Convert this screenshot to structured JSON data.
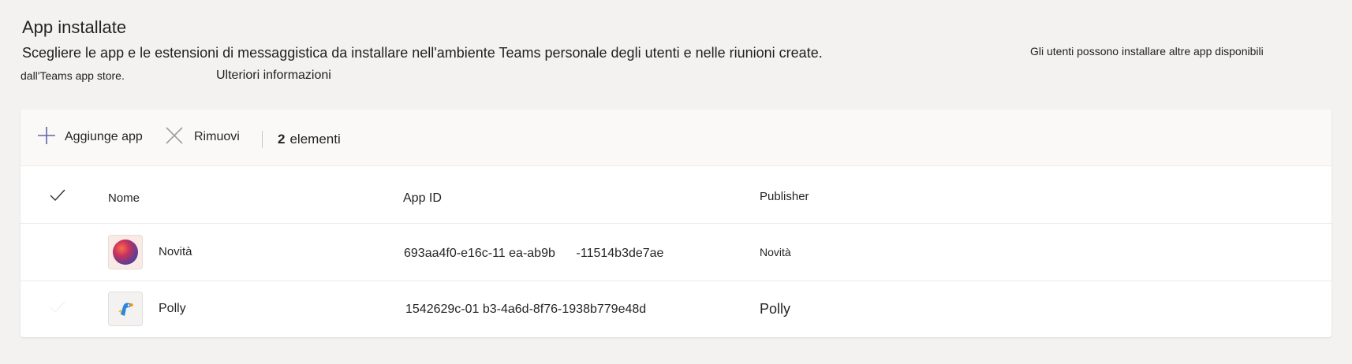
{
  "header": {
    "title": "App installate",
    "description": "Scegliere le app e le estensioni di messaggistica da installare nell'ambiente Teams personale degli utenti e nelle riunioni create.",
    "description_aside": "Gli utenti possono installare altre app disponibili",
    "description_line2": "dall'Teams app store.",
    "learn_more": "Ulteriori informazioni"
  },
  "toolbar": {
    "add_label": "Aggiunge app",
    "remove_label": "Rimuovi",
    "count_number": "2",
    "count_label": "elementi"
  },
  "table": {
    "columns": {
      "name": "Nome",
      "app_id": "App ID",
      "publisher": "Publisher"
    },
    "rows": [
      {
        "name": "Novità",
        "app_id": "693aa4f0-e16c-11 ea-ab9b      -11514b3de7ae",
        "publisher": "Novità",
        "icon": "whats-new-app-icon"
      },
      {
        "name": "Polly",
        "app_id": "1542629c-01 b3-4a6d-8f76-1938b779e48d",
        "publisher": "Polly",
        "icon": "polly-parrot-icon"
      }
    ]
  },
  "colors": {
    "background": "#f3f2f1",
    "card": "#ffffff",
    "toolbar": "#faf9f8",
    "accent": "#6264a7"
  }
}
